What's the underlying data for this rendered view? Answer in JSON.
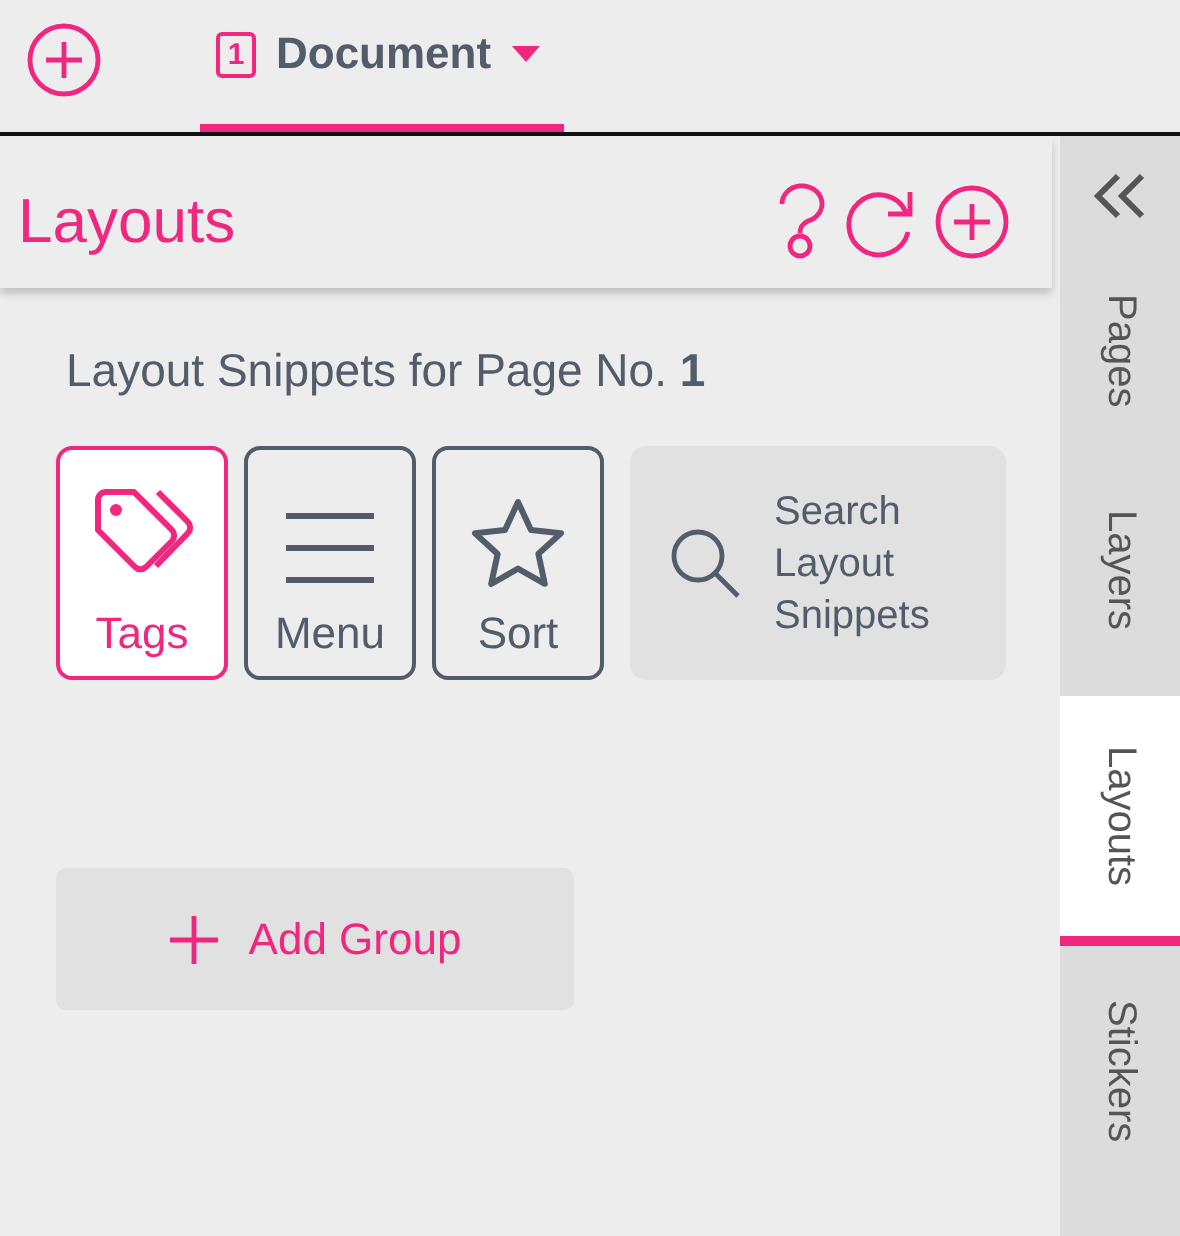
{
  "toolbar": {
    "tab": {
      "number": "1",
      "label": "Document",
      "selected": true
    }
  },
  "panel": {
    "title": "Layouts",
    "subtitle": "Layout Snippets for Page No. **1**",
    "tools": [
      {
        "kind": "tags",
        "label": "Tags",
        "selected": true
      },
      {
        "kind": "menu",
        "label": "Menu",
        "selected": false
      },
      {
        "kind": "sort",
        "label": "Sort",
        "selected": false
      }
    ],
    "search": {
      "label": "Search Layout Snippets"
    },
    "add_group": "Add Group"
  },
  "sidebar": {
    "tabs": [
      {
        "label": "Pages",
        "selected": false
      },
      {
        "label": "Layers",
        "selected": false
      },
      {
        "label": "Layouts",
        "selected": true
      },
      {
        "label": "Stickers",
        "selected": false
      }
    ]
  }
}
